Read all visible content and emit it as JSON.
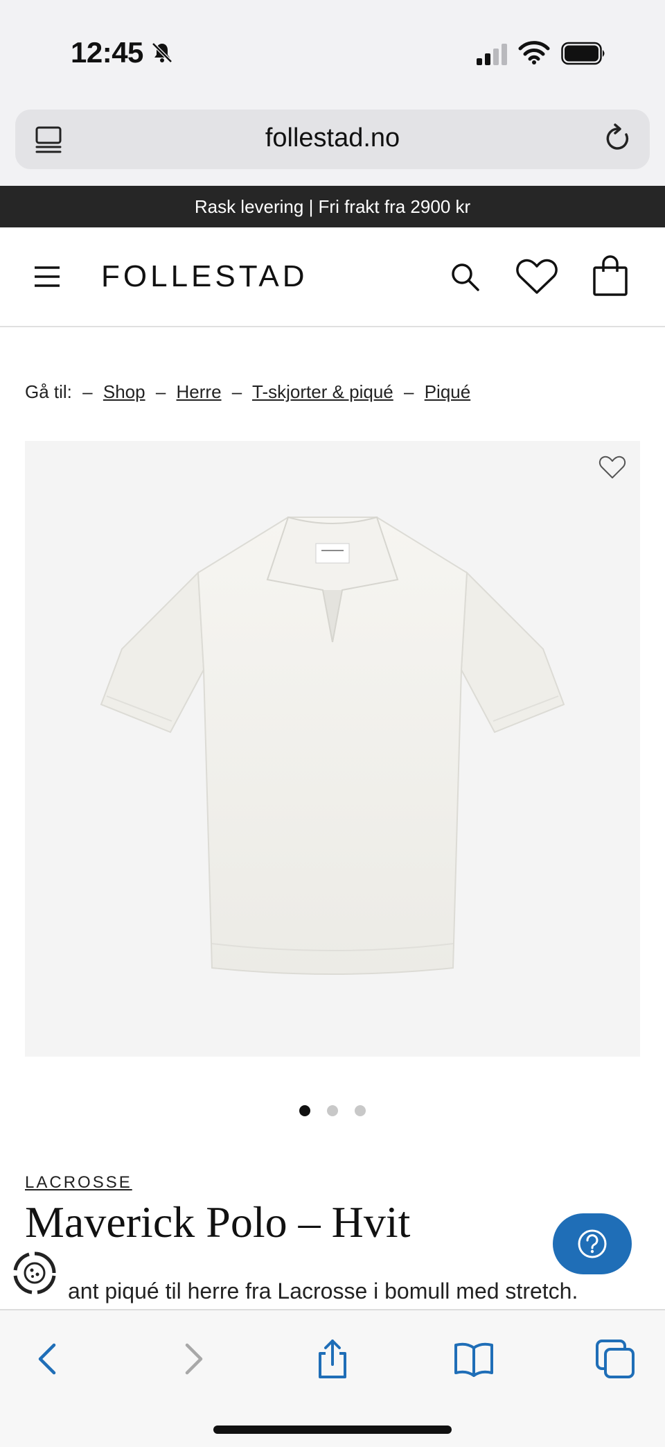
{
  "status_bar": {
    "time": "12:45",
    "icons": [
      "bell-slash-icon",
      "signal-icon",
      "wifi-icon",
      "battery-icon"
    ]
  },
  "browser": {
    "url": "follestad.no",
    "icons": [
      "tabs-overview-icon",
      "reload-icon"
    ]
  },
  "promo": {
    "text": "Rask levering | Fri frakt fra 2900 kr"
  },
  "header": {
    "logo": "FOLLESTAD",
    "icons": [
      "menu-icon",
      "search-icon",
      "heart-icon",
      "shopping-bag-icon"
    ]
  },
  "breadcrumb": {
    "prefix": "Gå til:",
    "separator": "–",
    "items": [
      {
        "label": "Shop"
      },
      {
        "label": "Herre"
      },
      {
        "label": "T-skjorter & piqué"
      },
      {
        "label": "Piqué"
      }
    ]
  },
  "gallery": {
    "image_alt": "white-polo-shirt",
    "dot_count": 3,
    "active_index": 0
  },
  "product": {
    "brand": "LACROSSE",
    "title": "Maverick Polo – Hvit",
    "description": "ant piqué til herre fra Lacrosse i bomull med stretch."
  },
  "floating": {
    "help_icon": "question-icon",
    "cookie_icon": "cookie-settings-icon"
  },
  "toolbar": {
    "buttons": [
      "back-icon",
      "forward-icon",
      "share-icon",
      "bookmarks-icon",
      "tabs-icon"
    ]
  },
  "colors": {
    "promo_bg": "#262626",
    "help_button": "#1f6eb7",
    "toolbar_icon": "#1f6eb7",
    "toolbar_icon_disabled": "#a8a8a8",
    "image_bg": "#f4f4f4"
  }
}
